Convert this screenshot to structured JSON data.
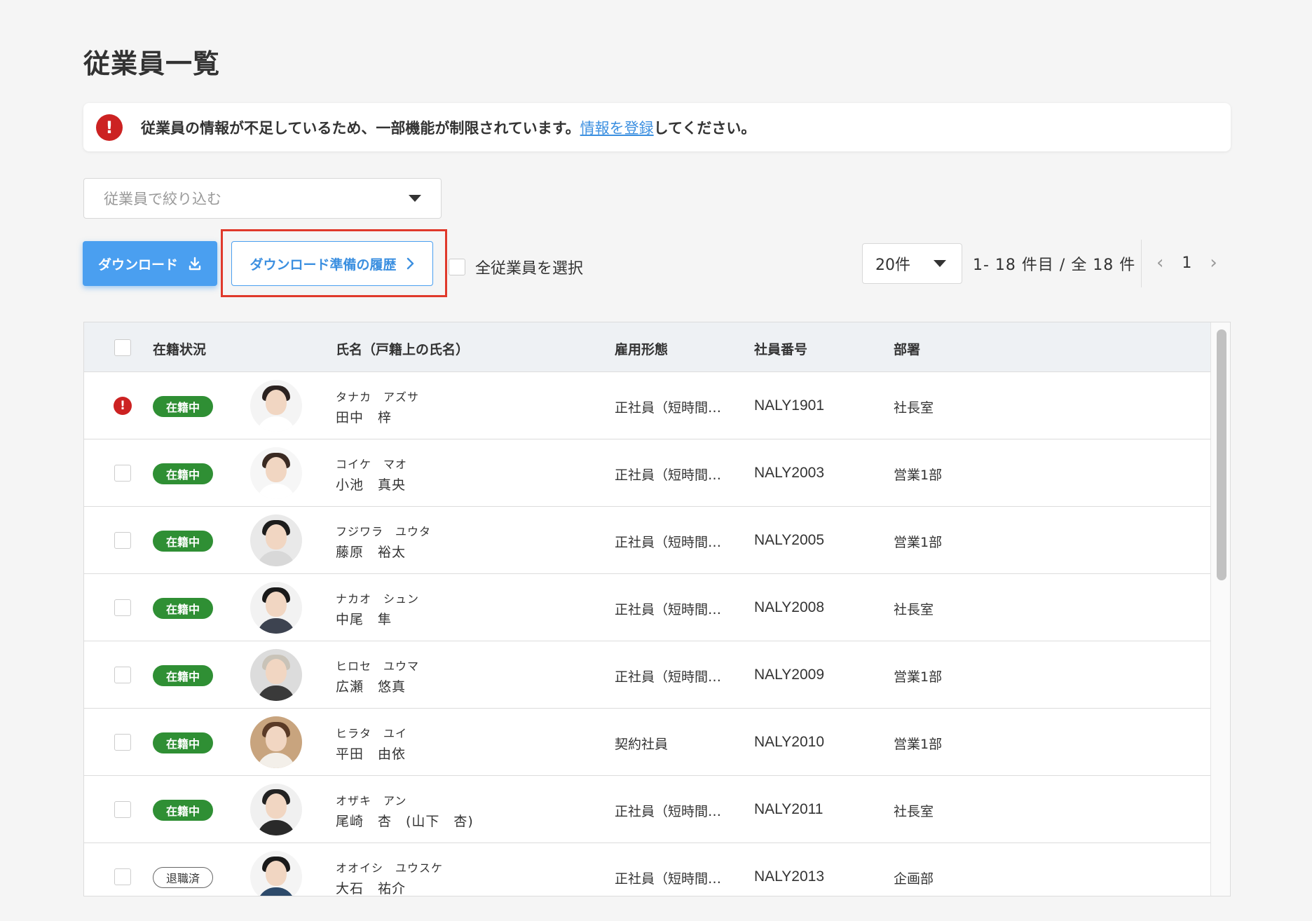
{
  "page_title": "従業員一覧",
  "alert": {
    "text_before": "従業員の情報が不足しているため、一部機能が制限されています。",
    "link": "情報を登録",
    "text_after": "してください。",
    "icon": "exclamation-circle-icon",
    "color": "#cc2222"
  },
  "filter": {
    "placeholder": "従業員で絞り込む"
  },
  "toolbar": {
    "download_label": "ダウンロード",
    "history_label": "ダウンロード準備の履歴",
    "select_all_label": "全従業員を選択",
    "per_page": "20件",
    "range": "1- 18 件目 /  全 18 件",
    "page": "1",
    "accent_color": "#4a9ff0"
  },
  "table": {
    "headers": {
      "status": "在籍状況",
      "name": "氏名（戸籍上の氏名）",
      "employment": "雇用形態",
      "emp_no": "社員番号",
      "dept": "部署"
    },
    "rows": [
      {
        "warning": true,
        "status": "在籍中",
        "status_type": "active",
        "kana": "タナカ　アズサ",
        "name": "田中　梓",
        "employment": "正社員（短時間…",
        "emp_no": "NALY1901",
        "dept": "社長室"
      },
      {
        "warning": false,
        "status": "在籍中",
        "status_type": "active",
        "kana": "コイケ　マオ",
        "name": "小池　真央",
        "employment": "正社員（短時間…",
        "emp_no": "NALY2003",
        "dept": "営業1部"
      },
      {
        "warning": false,
        "status": "在籍中",
        "status_type": "active",
        "kana": "フジワラ　ユウタ",
        "name": "藤原　裕太",
        "employment": "正社員（短時間…",
        "emp_no": "NALY2005",
        "dept": "営業1部"
      },
      {
        "warning": false,
        "status": "在籍中",
        "status_type": "active",
        "kana": "ナカオ　シュン",
        "name": "中尾　隼",
        "employment": "正社員（短時間…",
        "emp_no": "NALY2008",
        "dept": "社長室"
      },
      {
        "warning": false,
        "status": "在籍中",
        "status_type": "active",
        "kana": "ヒロセ　ユウマ",
        "name": "広瀬　悠真",
        "employment": "正社員（短時間…",
        "emp_no": "NALY2009",
        "dept": "営業1部"
      },
      {
        "warning": false,
        "status": "在籍中",
        "status_type": "active",
        "kana": "ヒラタ　ユイ",
        "name": "平田　由依",
        "employment": "契約社員",
        "emp_no": "NALY2010",
        "dept": "営業1部"
      },
      {
        "warning": false,
        "status": "在籍中",
        "status_type": "active",
        "kana": "オザキ　アン",
        "name": "尾崎　杏　(山下　杏)",
        "employment": "正社員（短時間…",
        "emp_no": "NALY2011",
        "dept": "社長室"
      },
      {
        "warning": false,
        "status": "退職済",
        "status_type": "retired",
        "kana": "オオイシ　ユウスケ",
        "name": "大石　祐介",
        "employment": "正社員（短時間…",
        "emp_no": "NALY2013",
        "dept": "企画部"
      }
    ]
  }
}
